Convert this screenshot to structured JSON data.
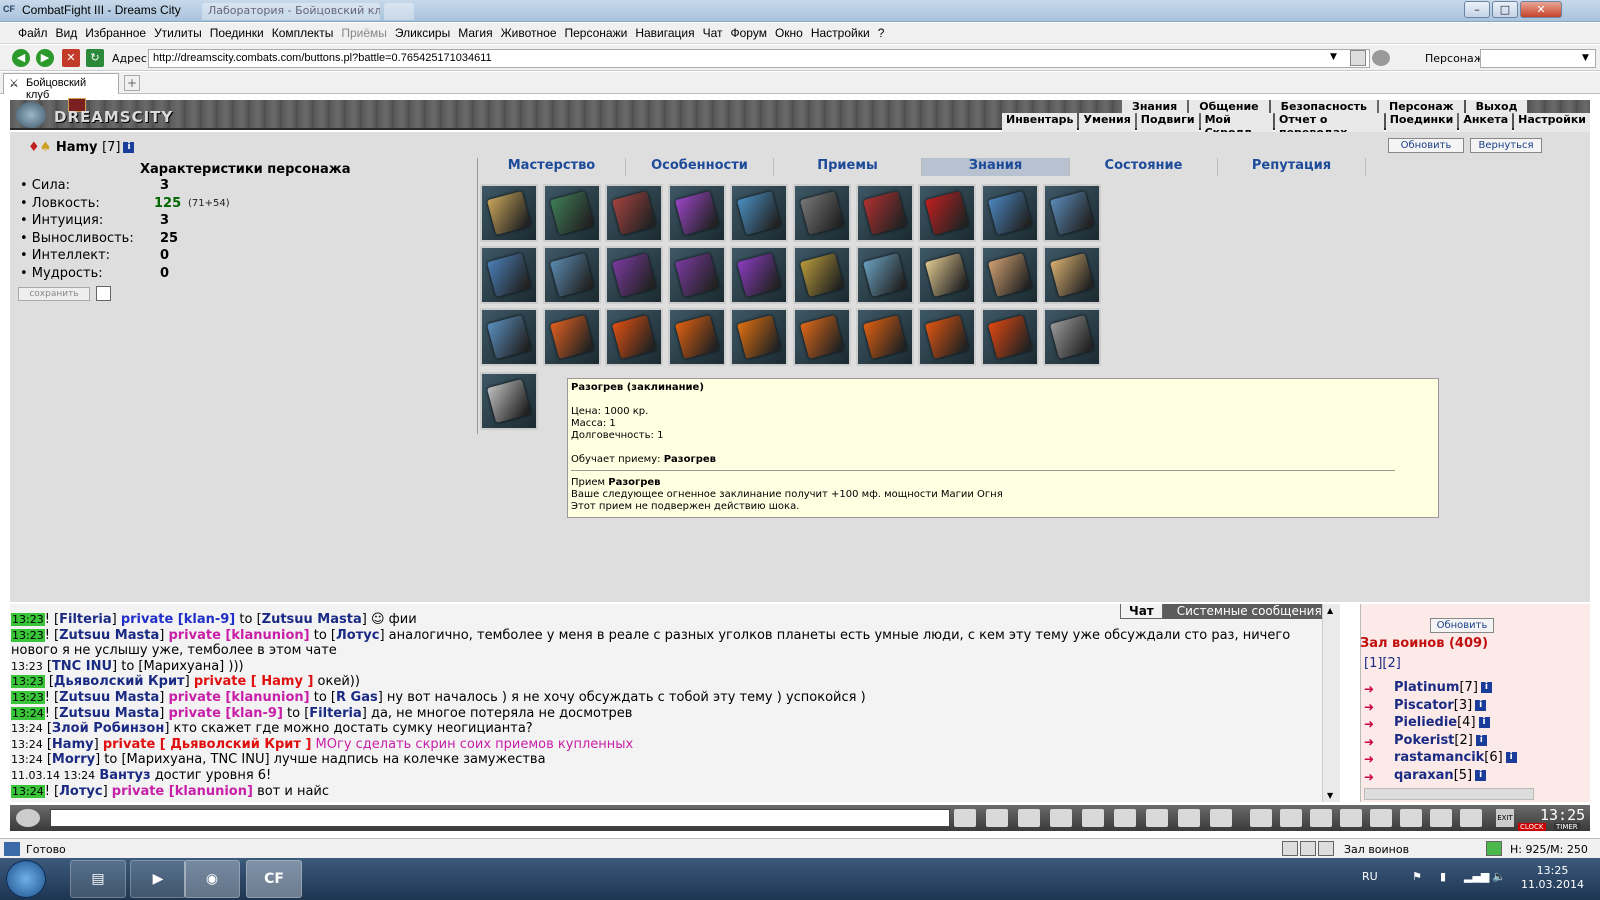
{
  "window": {
    "logo": "CF",
    "title": "CombatFight III - Dreams City",
    "bg_tab": "Лаборатория - Бойцовский клуб"
  },
  "menu": [
    "Файл",
    "Вид",
    "Избранное",
    "Утилиты",
    "Поединки",
    "Комплекты",
    "Приёмы",
    "Эликсиры",
    "Магия",
    "Животное",
    "Персонажи",
    "Навигация",
    "Чат",
    "Форум",
    "Окно",
    "Настройки",
    "?"
  ],
  "address": {
    "label": "Адрес:",
    "url": "http://dreamscity.combats.com/buttons.pl?battle=0.765425171034611",
    "character_label": "Персонаж:"
  },
  "tab": {
    "label": "Бойцовский клуб"
  },
  "game": {
    "logo": "DREAMSCITY",
    "topnav1": [
      "Знания",
      "Общение",
      "Безопасность",
      "Персонаж",
      "Выход"
    ],
    "topnav2": [
      "Инвентарь",
      "Умения",
      "Подвиги",
      "Мой Скролл",
      "Отчет о переводах",
      "Поединки",
      "Анкета",
      "Настройки"
    ]
  },
  "character": {
    "name": "Hamy",
    "level": "[7]",
    "stats_title": "Характеристики персонажа",
    "stats": [
      {
        "label": "• Сила:",
        "value": "3"
      },
      {
        "label": "• Ловкость:",
        "value": "125",
        "extra": "(71+54)"
      },
      {
        "label": "• Интуиция:",
        "value": "3"
      },
      {
        "label": "• Выносливость:",
        "value": "25"
      },
      {
        "label": "• Интеллект:",
        "value": "0"
      },
      {
        "label": "• Мудрость:",
        "value": "0"
      }
    ],
    "save_label": "сохранить"
  },
  "tabs": [
    "Мастерство",
    "Особенности",
    "Приемы",
    "Знания",
    "Состояние",
    "Репутация"
  ],
  "buttons": {
    "refresh": "Обновить",
    "back": "Вернуться"
  },
  "tooltip": {
    "title": "Разогрев (заклинание)",
    "price": "Цена: 1000 кр.",
    "mass": "Масса: 1",
    "durability": "Долговечность: 1",
    "teaches_prefix": "Обучает приему:",
    "teaches_name": "Разогрев",
    "trick_prefix": "Прием",
    "trick_name": "Разогрев",
    "description": "Ваше следующее огненное заклинание получит +100 мф. мощности Магии Огня",
    "note": "Этот прием не подвержен действию шока."
  },
  "cards": {
    "colors": [
      [
        "#c9a55a",
        "#3f7d56",
        "#a3433f",
        "#9a45c6",
        "#4a8fc2",
        "#777777",
        "#b03030",
        "#c02020",
        "#4a86c0",
        "#5a8ab8"
      ],
      [
        "#4a7fb8",
        "#5a8ab0",
        "#7a3aa0",
        "#7a3aa0",
        "#8a3cc0",
        "#b89a3a",
        "#6aa0c0",
        "#e0c890",
        "#d0a070",
        "#d8b070"
      ],
      [
        "#5a90c0",
        "#e06020",
        "#e05010",
        "#e06010",
        "#e07010",
        "#e06818",
        "#e06010",
        "#e05510",
        "#e04810",
        "#9a9a9a"
      ],
      [
        "#c0c0c0"
      ]
    ]
  },
  "chat": {
    "tabs": {
      "chat": "Чат",
      "system": "Системные сообщения"
    },
    "lines": [
      {
        "ts": "13:23",
        "parts": [
          [
            "t",
            "! ["
          ],
          [
            "n",
            "Filteria"
          ],
          [
            "t",
            "] "
          ],
          [
            "pb",
            "private [klan-9]"
          ],
          [
            "t",
            " to ["
          ],
          [
            "n",
            "Zutsuu Masta"
          ],
          [
            "t",
            "] ☺ фии"
          ]
        ]
      },
      {
        "ts": "13:23",
        "parts": [
          [
            "t",
            "! ["
          ],
          [
            "n",
            "Zutsuu Masta"
          ],
          [
            "t",
            "] "
          ],
          [
            "p",
            "private [klanunion]"
          ],
          [
            "t",
            " to ["
          ],
          [
            "n",
            "Лотус"
          ],
          [
            "t",
            "] аналогично, темболее у меня в реале с разных уголков планеты есть умные люди, с кем эту тему уже обсуждали сто раз, ничего"
          ]
        ]
      },
      {
        "ts": "",
        "parts": [
          [
            "t",
            "нового я не услышу уже, темболее в этом чате"
          ]
        ]
      },
      {
        "ts": "13:23",
        "plain": true,
        "parts": [
          [
            "t",
            " ["
          ],
          [
            "n",
            "TNC INU"
          ],
          [
            "t",
            "] to [Марихуана] )))"
          ]
        ]
      },
      {
        "ts": "13:23",
        "parts": [
          [
            "t",
            " ["
          ],
          [
            "n",
            "Дьяволский Крит"
          ],
          [
            "t",
            "] "
          ],
          [
            "pr",
            "private [ Hamy ]"
          ],
          [
            "t",
            " окей))"
          ]
        ]
      },
      {
        "ts": "13:23",
        "parts": [
          [
            "t",
            "! ["
          ],
          [
            "n",
            "Zutsuu Masta"
          ],
          [
            "t",
            "] "
          ],
          [
            "p",
            "private [klanunion]"
          ],
          [
            "t",
            " to ["
          ],
          [
            "n",
            "R Gas"
          ],
          [
            "t",
            "] ну вот началось ) я не хочу обсуждать с тобой эту тему ) успокойся )"
          ]
        ]
      },
      {
        "ts": "13:24",
        "parts": [
          [
            "t",
            "! ["
          ],
          [
            "n",
            "Zutsuu Masta"
          ],
          [
            "t",
            "] "
          ],
          [
            "p",
            "private [klan-9]"
          ],
          [
            "t",
            " to ["
          ],
          [
            "n",
            "Filteria"
          ],
          [
            "t",
            "] да, не многое потеряла не досмотрев"
          ]
        ]
      },
      {
        "ts": "13:24",
        "plain": true,
        "parts": [
          [
            "t",
            " ["
          ],
          [
            "n",
            "Злой Робинзон"
          ],
          [
            "t",
            "] кто скажет где можно достать сумку неогицианта?"
          ]
        ]
      },
      {
        "ts": "13:24",
        "plain": true,
        "parts": [
          [
            "t",
            " ["
          ],
          [
            "n",
            "Hamy"
          ],
          [
            "t",
            "] "
          ],
          [
            "pr",
            "private [ Дьяволский Крит ]"
          ],
          [
            "m",
            " МОгу сделать скрин соих приемов купленных"
          ]
        ]
      },
      {
        "ts": "13:24",
        "plain": true,
        "parts": [
          [
            "t",
            " ["
          ],
          [
            "n",
            "Morry"
          ],
          [
            "t",
            "] to [Марихуана, TNC INU] лучше надпись на колечке замужества"
          ]
        ]
      },
      {
        "ts": "11.03.14 13:24",
        "plain": true,
        "parts": [
          [
            "t",
            " "
          ],
          [
            "n2",
            "Вантуз"
          ],
          [
            "t",
            " достиг уровня 6!"
          ]
        ]
      },
      {
        "ts": "13:24",
        "parts": [
          [
            "t",
            "! ["
          ],
          [
            "n",
            "Лотус"
          ],
          [
            "t",
            "] "
          ],
          [
            "p",
            "private [klanunion]"
          ],
          [
            "t",
            " вот и найс"
          ]
        ]
      }
    ]
  },
  "hall": {
    "refresh": "Обновить",
    "title": "Зал воинов (409)",
    "pages": "[1][2]",
    "players": [
      {
        "name": "Platinum",
        "level": "[7]"
      },
      {
        "name": "Piscator",
        "level": "[3]"
      },
      {
        "name": "Pieliedie",
        "level": "[4]"
      },
      {
        "name": "Pokerist",
        "level": "[2]"
      },
      {
        "name": "rastamancik",
        "level": "[6]"
      },
      {
        "name": "qaraxan",
        "level": "[5]"
      }
    ]
  },
  "clock": "13:25",
  "clock_labels": {
    "exit": "EXIT",
    "clock": "CLOCK",
    "timer": "TIMER"
  },
  "status": {
    "text": "Готово",
    "zone": "Зал воинов",
    "hp": "H: 925/M: 250"
  },
  "taskbar": {
    "lang": "RU",
    "time": "13:25",
    "date": "11.03.2014",
    "cf_label": "CF"
  }
}
